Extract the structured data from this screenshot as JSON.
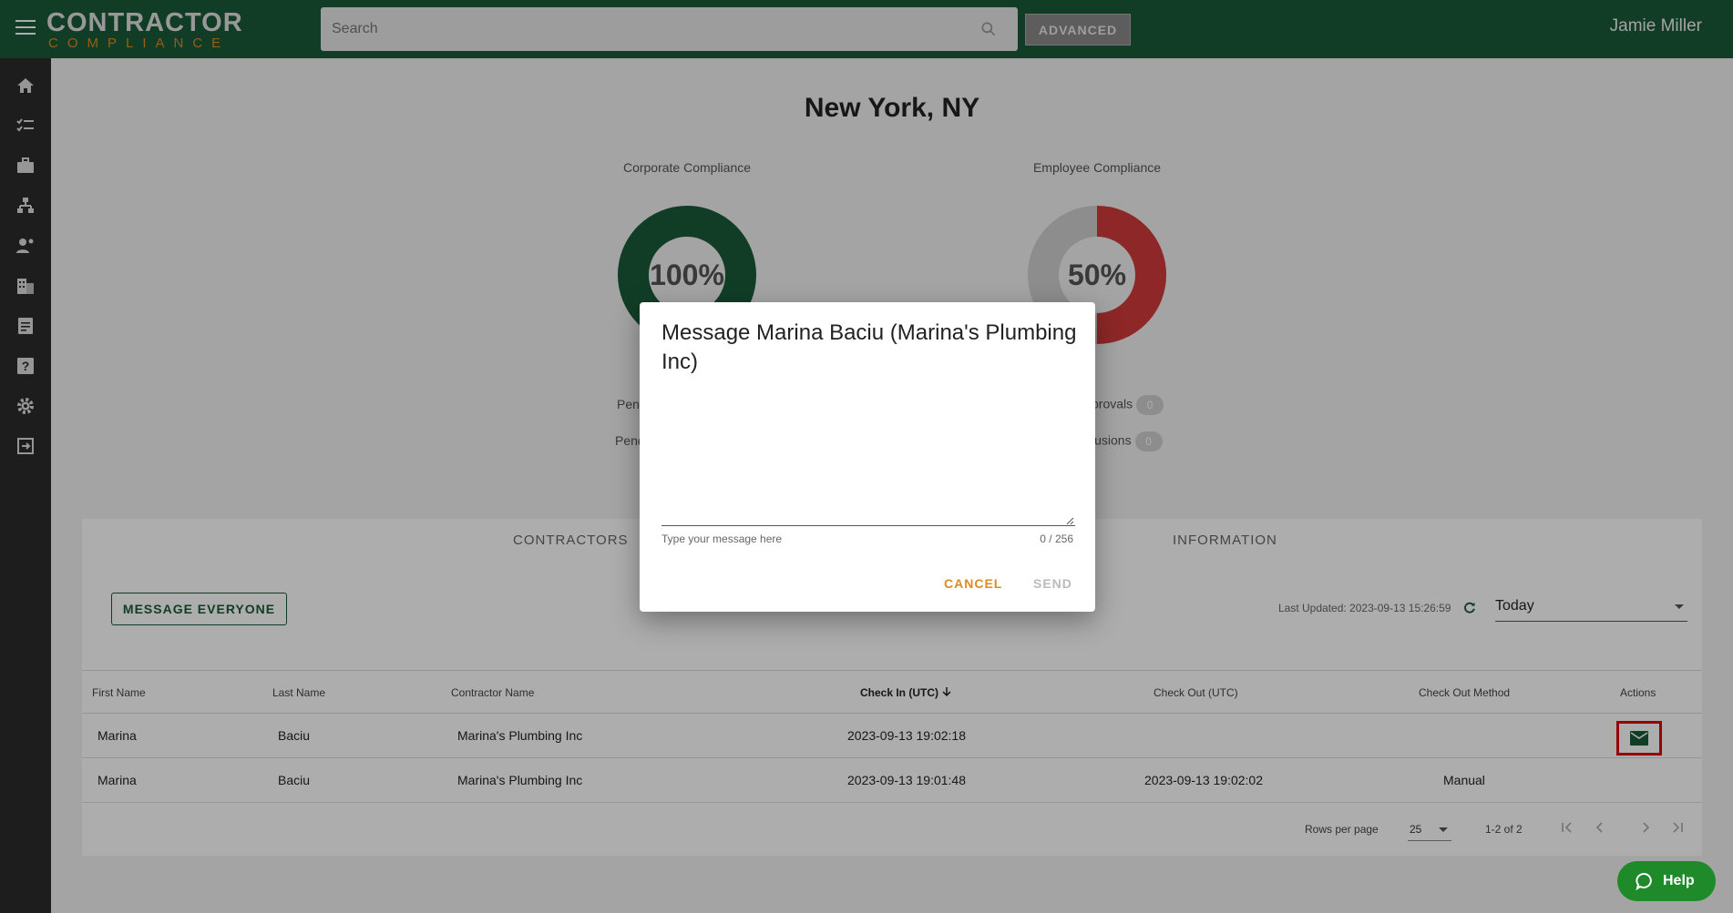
{
  "header": {
    "logo_top": "CONTRACTOR",
    "logo_bottom": "COMPLIANCE",
    "search_placeholder": "Search",
    "advanced_label": "ADVANCED",
    "user_name": "Jamie Miller"
  },
  "sidebar": {
    "icons": [
      "home-icon",
      "checklist-icon",
      "briefcase-icon",
      "org-chart-icon",
      "people-icon",
      "building-icon",
      "document-icon",
      "help-box-icon",
      "gear-icon",
      "logout-icon"
    ]
  },
  "main": {
    "title": "New York, NY",
    "corporate": {
      "label": "Corporate Compliance",
      "value": "100%",
      "percent": 100,
      "color": "#1a5a38"
    },
    "employee": {
      "label": "Employee Compliance",
      "value": "50%",
      "percent": 50,
      "color": "#d23a3a",
      "track": "#d0d0d0"
    },
    "left_stats": [
      {
        "label": "Pen"
      },
      {
        "label": "Pend"
      }
    ],
    "right_stats": [
      {
        "label": "provals",
        "count": "0"
      },
      {
        "label": "lusions",
        "count": "0"
      }
    ],
    "tabs": {
      "contractors": "CONTRACTORS",
      "information": "INFORMATION"
    },
    "message_everyone": "MESSAGE EVERYONE",
    "last_updated": "Last Updated: 2023-09-13 15:26:59",
    "date_filter": "Today"
  },
  "table": {
    "columns": {
      "first_name": "First Name",
      "last_name": "Last Name",
      "contractor": "Contractor Name",
      "check_in": "Check In (UTC)",
      "check_out": "Check Out (UTC)",
      "check_out_method": "Check Out Method",
      "actions": "Actions"
    },
    "rows": [
      {
        "first": "Marina",
        "last": "Baciu",
        "contractor": "Marina's Plumbing Inc",
        "check_in": "2023-09-13 19:02:18",
        "check_out": "",
        "method": ""
      },
      {
        "first": "Marina",
        "last": "Baciu",
        "contractor": "Marina's Plumbing Inc",
        "check_in": "2023-09-13 19:01:48",
        "check_out": "2023-09-13 19:02:02",
        "method": "Manual"
      }
    ],
    "pagination": {
      "rows_per_page_label": "Rows per page",
      "rows_per_page": "25",
      "range": "1-2 of 2"
    }
  },
  "modal": {
    "title": "Message Marina Baciu (Marina's Plumbing Inc)",
    "hint": "Type your message here",
    "counter": "0 / 256",
    "cancel": "CANCEL",
    "send": "SEND"
  },
  "help": {
    "label": "Help"
  }
}
